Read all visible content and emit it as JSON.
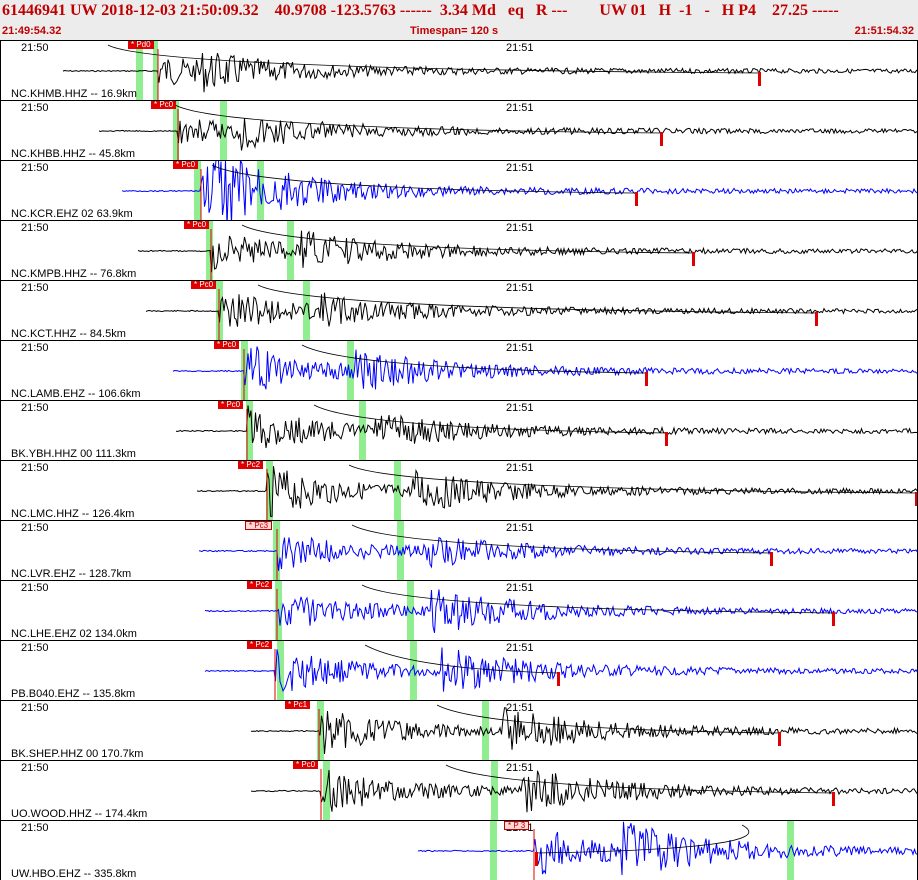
{
  "header": {
    "info": "61446941 UW 2018-12-03 21:50:09.32    40.9708 -123.5763 ------  3.34 Md   eq   R ---        UW 01   H  -1   -   H P4    27.25 -----",
    "start_time": "21:49:54.32",
    "timespan": "Timespan= 120 s",
    "end_time": "21:51:54.32"
  },
  "colors": {
    "header_text": "#c00000",
    "trace_black": "#000000",
    "trace_blue": "#0000ff",
    "pick_red": "#e00000",
    "green_marker": "#90ee90"
  },
  "tick_labels": {
    "a": "21:50",
    "b": "21:51"
  },
  "traces": [
    {
      "station": "NC.KHMB.HHZ -- 16.9km",
      "pick": "* Pd0",
      "color": "black",
      "light": false
    },
    {
      "station": "NC.KHBB.HHZ -- 45.8km",
      "pick": "* Pc0",
      "color": "black",
      "light": false
    },
    {
      "station": "NC.KCR.EHZ 02 63.9km",
      "pick": "* Pc0",
      "color": "blue",
      "light": false
    },
    {
      "station": "NC.KMPB.HHZ -- 76.8km",
      "pick": "* Pc0",
      "color": "black",
      "light": false
    },
    {
      "station": "NC.KCT.HHZ -- 84.5km",
      "pick": "* Pc0",
      "color": "black",
      "light": false
    },
    {
      "station": "NC.LAMB.EHZ -- 106.6km",
      "pick": "* Pc0",
      "color": "blue",
      "light": false
    },
    {
      "station": "BK.YBH.HHZ 00 111.3km",
      "pick": "* Pc0",
      "color": "black",
      "light": false
    },
    {
      "station": "NC.LMC.HHZ -- 126.4km",
      "pick": "* Pc2",
      "color": "black",
      "light": false
    },
    {
      "station": "NC.LVR.EHZ -- 128.7km",
      "pick": "* Pc3",
      "color": "blue",
      "light": true
    },
    {
      "station": "NC.LHE.EHZ 02 134.0km",
      "pick": "* Pc2",
      "color": "blue",
      "light": false
    },
    {
      "station": "PB.B040.EHZ -- 135.8km",
      "pick": "* Pc2",
      "color": "blue",
      "light": false
    },
    {
      "station": "BK.SHEP.HHZ 00 170.7km",
      "pick": "* Pc1",
      "color": "black",
      "light": false
    },
    {
      "station": "UO.WOOD.HHZ -- 174.4km",
      "pick": "* Pc0",
      "color": "black",
      "light": false
    },
    {
      "station": "UW.HBO.EHZ -- 335.8km",
      "pick": "* P 3",
      "color": "blue",
      "light": true
    }
  ]
}
